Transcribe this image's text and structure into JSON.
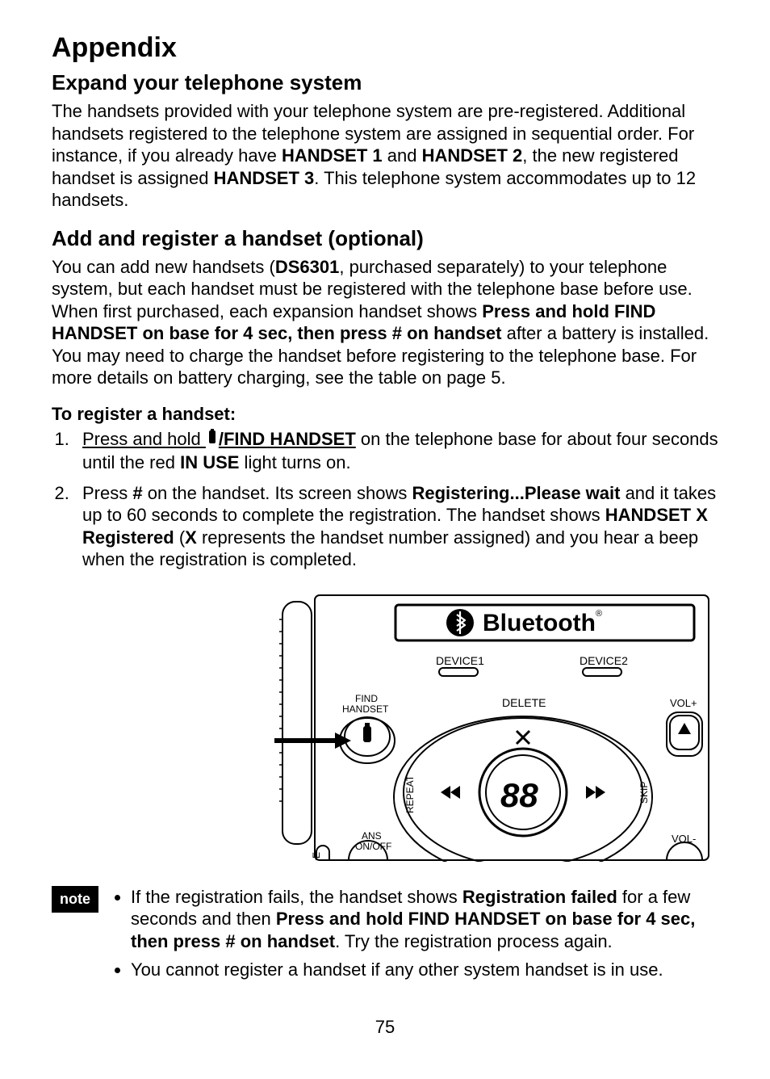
{
  "heading": "Appendix",
  "section1": {
    "title": "Expand your telephone system",
    "para_pre": "The handsets provided with your telephone system are pre-registered. Additional handsets registered to the telephone system are assigned in sequential order. For instance, if you already have ",
    "h1": "HANDSET 1",
    "mid1": " and ",
    "h2": "HANDSET 2",
    "mid2": ", the new registered handset is assigned ",
    "h3": "HANDSET 3",
    "post": ". This telephone system accommodates up to 12 handsets."
  },
  "section2": {
    "title": "Add and register a handset (optional)",
    "para_pre": "You can add new handsets (",
    "model": "DS6301",
    "mid1": ", purchased separately) to your telephone system, but each handset must be registered with the telephone base before use. When first purchased, each expansion handset shows ",
    "bold_msg": "Press and hold FIND HANDSET on base for 4 sec, then press # on handset",
    "post": " after a battery is installed. You may need to charge the handset before registering to the telephone base. For more details on battery charging, see the table on page 5."
  },
  "register": {
    "title": "To register a handset:",
    "step1": {
      "pre_u": "Press and hold ",
      "find_handset": "/FIND HANDSET",
      "mid": " on the telephone base for about four seconds until the red ",
      "inuse": "IN USE",
      "post": " light turns on."
    },
    "step2": {
      "pre": "Press ",
      "hash": "#",
      "mid1": " on the handset. Its screen shows ",
      "regwait": "Registering...Please wait",
      "mid2": " and it takes up to 60 seconds to complete the registration. The handset shows ",
      "hxreg": "HANDSET X Registered",
      "mid3": " (",
      "x": "X",
      "mid4": " represents the handset number assigned) and you hear a beep when the registration is completed."
    }
  },
  "diagram": {
    "bluetooth": "Bluetooth",
    "device1": "DEVICE1",
    "device2": "DEVICE2",
    "find_handset": "FIND\nHANDSET",
    "delete": "DELETE",
    "volp": "VOL+",
    "volm": "VOL-",
    "repeat": "REPEAT",
    "skip": "SKIP",
    "ans": "ANS\nON/OFF",
    "counter": "88"
  },
  "notes": {
    "label": "note",
    "n1_pre": "If the registration fails, the handset shows ",
    "n1_b1": "Registration failed",
    "n1_mid": " for a few seconds and then ",
    "n1_b2": "Press and hold FIND HANDSET on base for 4 sec, then press # on handset",
    "n1_post": ". Try the registration process again.",
    "n2": "You cannot register a handset if any other system handset is in use."
  },
  "page_number": "75"
}
